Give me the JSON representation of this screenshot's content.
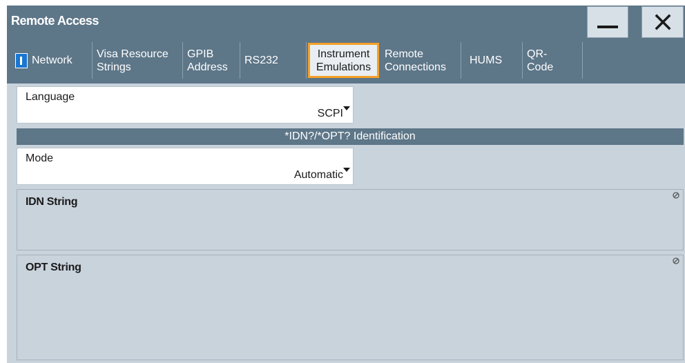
{
  "window": {
    "title": "Remote Access"
  },
  "titlebar_buttons": {
    "minimize": "minimize-icon",
    "close": "close-icon"
  },
  "tabs": [
    {
      "label_line1": "Network",
      "label_line2": "",
      "icon": "info-icon"
    },
    {
      "label_line1": "Visa Resource",
      "label_line2": "Strings"
    },
    {
      "label_line1": "GPIB",
      "label_line2": "Address"
    },
    {
      "label_line1": "RS232",
      "label_line2": ""
    },
    {
      "label_line1": "Instrument",
      "label_line2": "Emulations",
      "active": true
    },
    {
      "label_line1": "Remote",
      "label_line2": "Connections"
    },
    {
      "label_line1": "HUMS",
      "label_line2": ""
    },
    {
      "label_line1": "QR-",
      "label_line2": "Code"
    }
  ],
  "language": {
    "label": "Language",
    "value": "SCPI"
  },
  "section": {
    "title": "*IDN?/*OPT? Identification"
  },
  "mode": {
    "label": "Mode",
    "value": "Automatic"
  },
  "idn_string": {
    "label": "IDN String",
    "value": "",
    "icon": "read-only-icon"
  },
  "opt_string": {
    "label": "OPT String",
    "value": "",
    "icon": "read-only-icon"
  },
  "colors": {
    "titlebar": "#5d7688",
    "panel": "#c9d3dc",
    "active_tab_border": "#f5a127",
    "info_icon": "#1976d2"
  }
}
